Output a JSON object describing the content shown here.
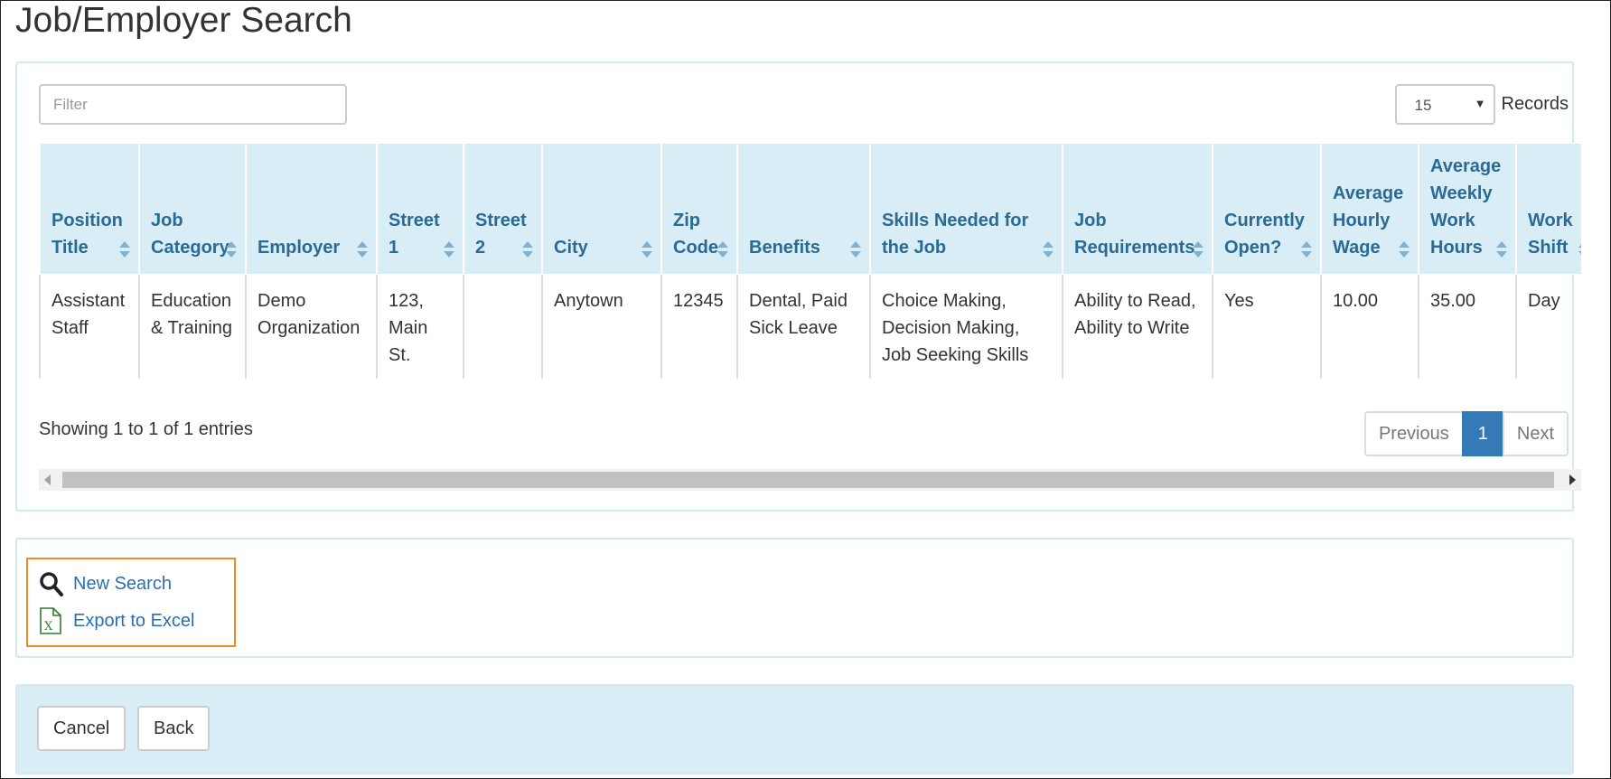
{
  "page": {
    "title": "Job/Employer Search"
  },
  "filter": {
    "placeholder": "Filter"
  },
  "records": {
    "value": "15",
    "label": "Records"
  },
  "table": {
    "columns": [
      "Position Title",
      "Job Category",
      "Employer",
      "Street 1",
      "Street 2",
      "City",
      "Zip Code",
      "Benefits",
      "Skills Needed for the Job",
      "Job Requirements",
      "Currently Open?",
      "Average Hourly Wage",
      "Average Weekly Work Hours",
      "Work Shift"
    ],
    "rows": [
      {
        "cells": [
          "Assistant Staff",
          "Education & Training",
          "Demo Organization",
          "123, Main St.",
          "",
          "Anytown",
          "12345",
          "Dental, Paid Sick Leave",
          "Choice Making, Decision Making, Job Seeking Skills",
          "Ability to Read, Ability to Write",
          "Yes",
          "10.00",
          "35.00",
          "Day"
        ]
      }
    ]
  },
  "pagination": {
    "info": "Showing 1 to 1 of 1 entries",
    "previous": "Previous",
    "current": "1",
    "next": "Next"
  },
  "actions": {
    "new_search": {
      "label": "New Search",
      "icon": "search-icon"
    },
    "export": {
      "label": "Export to Excel",
      "icon": "excel-file-icon"
    }
  },
  "footer": {
    "cancel": "Cancel",
    "back": "Back"
  },
  "colors": {
    "accent": "#337ab7",
    "header_bg": "#d9edf7",
    "header_text": "#2a6a93",
    "highlight_border": "#f08a24"
  }
}
